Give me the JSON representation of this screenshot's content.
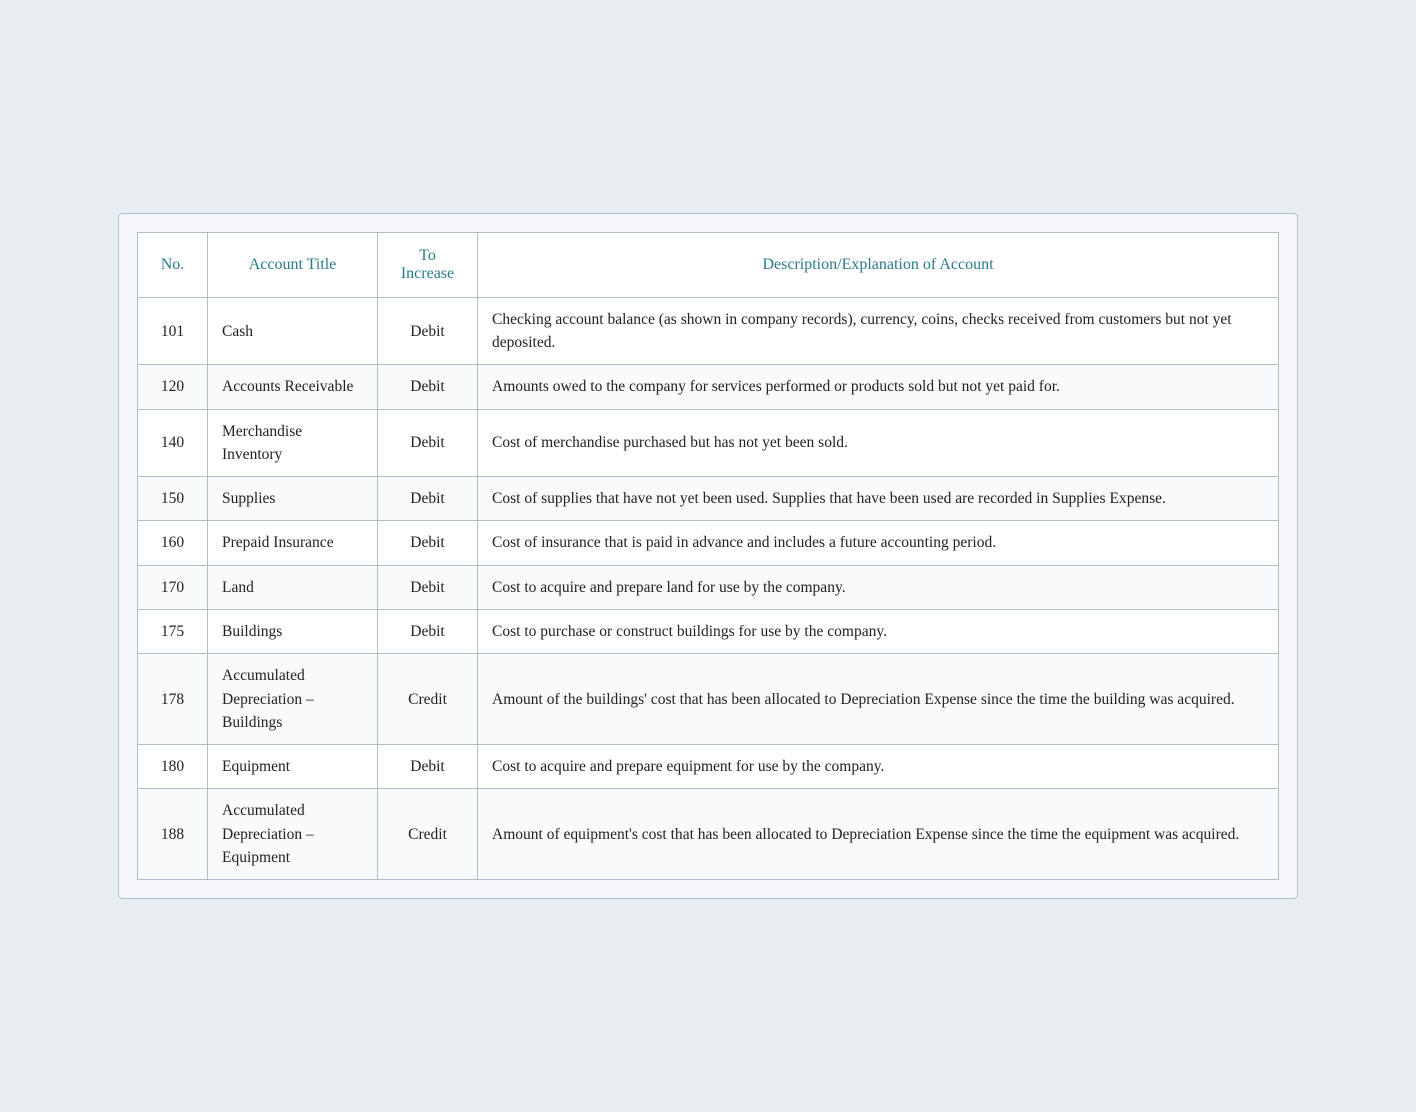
{
  "table": {
    "headers": [
      {
        "key": "no",
        "label": "No."
      },
      {
        "key": "title",
        "label": "Account Title"
      },
      {
        "key": "toIncrease",
        "label": "To Increase"
      },
      {
        "key": "description",
        "label": "Description/Explanation of Account"
      }
    ],
    "rows": [
      {
        "no": "101",
        "title": "Cash",
        "toIncrease": "Debit",
        "description": "Checking account balance (as shown in company records), currency, coins, checks received from customers but not yet deposited."
      },
      {
        "no": "120",
        "title": "Accounts Receivable",
        "toIncrease": "Debit",
        "description": "Amounts owed to the company for services performed or products sold but not yet paid for."
      },
      {
        "no": "140",
        "title": "Merchandise Inventory",
        "toIncrease": "Debit",
        "description": "Cost of merchandise purchased but has not yet been sold."
      },
      {
        "no": "150",
        "title": "Supplies",
        "toIncrease": "Debit",
        "description": "Cost of supplies that have not yet been used. Supplies that have been used are recorded in Supplies Expense."
      },
      {
        "no": "160",
        "title": "Prepaid Insurance",
        "toIncrease": "Debit",
        "description": "Cost of insurance that is paid in advance and includes a future accounting period."
      },
      {
        "no": "170",
        "title": "Land",
        "toIncrease": "Debit",
        "description": "Cost to acquire and prepare land for use by the company."
      },
      {
        "no": "175",
        "title": "Buildings",
        "toIncrease": "Debit",
        "description": "Cost to purchase or construct buildings for use by the company."
      },
      {
        "no": "178",
        "title": "Accumulated Depreciation – Buildings",
        "toIncrease": "Credit",
        "description": "Amount of the buildings' cost that has been allocated to Depreciation Expense since the time the building was acquired."
      },
      {
        "no": "180",
        "title": "Equipment",
        "toIncrease": "Debit",
        "description": "Cost to acquire and prepare equipment for use by the company."
      },
      {
        "no": "188",
        "title": "Accumulated Depreciation – Equipment",
        "toIncrease": "Credit",
        "description": "Amount of equipment's cost that has been allocated to Depreciation Expense since the time the equipment was acquired."
      }
    ]
  }
}
